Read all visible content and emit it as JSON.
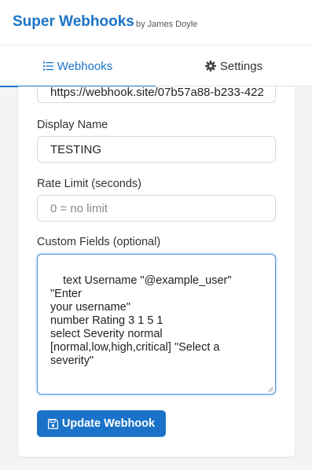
{
  "header": {
    "title": "Super Webhooks",
    "byline": "by James Doyle"
  },
  "tabs": [
    {
      "label": "Webhooks",
      "icon": "list-icon",
      "active": true
    },
    {
      "label": "Settings",
      "icon": "gear-icon",
      "active": false
    }
  ],
  "form": {
    "url_value": "https://webhook.site/07b57a88-b233-422",
    "display_name_label": "Display Name",
    "display_name_value": "TESTING",
    "rate_limit_label": "Rate Limit (seconds)",
    "rate_limit_placeholder": "0 = no limit",
    "custom_fields_label": "Custom Fields (optional)",
    "custom_fields_value": "text Username \"@example_user\" \"Enter\nyour username\"\nnumber Rating 3 1 5 1\nselect Severity normal\n[normal,low,high,critical] \"Select a\nseverity\"",
    "submit_label": "Update Webhook"
  },
  "colors": {
    "accent": "#1a73c8",
    "background": "#f3f4f6"
  }
}
